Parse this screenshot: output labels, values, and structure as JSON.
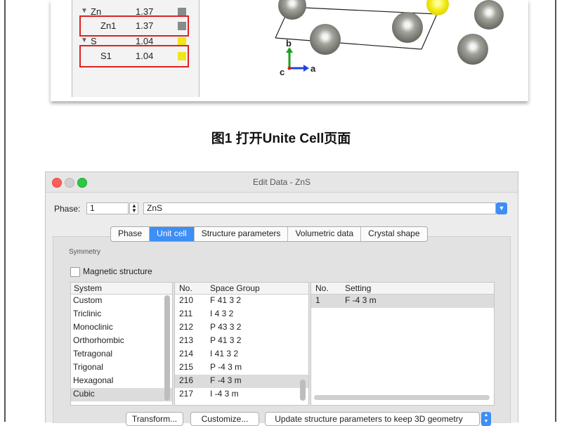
{
  "top_panel": {
    "tree": [
      {
        "name": "Zn",
        "value": "1.37",
        "color": "#8a8a8a",
        "expanded": true
      },
      {
        "name": "Zn1",
        "value": "1.37",
        "color": "#8a8a8a",
        "highlighted": true
      },
      {
        "name": "S",
        "value": "1.04",
        "color": "#f0e61a",
        "expanded": true
      },
      {
        "name": "S1",
        "value": "1.04",
        "color": "#f0e61a",
        "highlighted": true
      }
    ],
    "axes": {
      "b": "b",
      "c": "c",
      "a": "a"
    }
  },
  "caption": "图1 打开Unite Cell页面",
  "dialog": {
    "title": "Edit Data - ZnS",
    "phase_label": "Phase:",
    "phase_value": "1",
    "phase_name": "ZnS",
    "tabs": [
      "Phase",
      "Unit cell",
      "Structure parameters",
      "Volumetric data",
      "Crystal shape"
    ],
    "active_tab": "Unit cell",
    "symmetry_label": "Symmetry",
    "magnetic_label": "Magnetic structure",
    "system_header": "System",
    "systems": [
      "Custom",
      "Triclinic",
      "Monoclinic",
      "Orthorhombic",
      "Tetragonal",
      "Trigonal",
      "Hexagonal",
      "Cubic"
    ],
    "selected_system": "Cubic",
    "space_group_headers": {
      "no": "No.",
      "name": "Space Group"
    },
    "space_groups": [
      {
        "no": "210",
        "name": "F 41 3 2"
      },
      {
        "no": "211",
        "name": "I 4 3 2"
      },
      {
        "no": "212",
        "name": "P 43 3 2"
      },
      {
        "no": "213",
        "name": "P 41 3 2"
      },
      {
        "no": "214",
        "name": "I 41 3 2"
      },
      {
        "no": "215",
        "name": "P -4 3 m"
      },
      {
        "no": "216",
        "name": "F -4 3 m"
      },
      {
        "no": "217",
        "name": "I -4 3 m"
      }
    ],
    "selected_space_group": "216",
    "setting_headers": {
      "no": "No.",
      "name": "Setting"
    },
    "settings": [
      {
        "no": "1",
        "name": "F -4 3 m"
      }
    ],
    "buttons": {
      "transform": "Transform...",
      "customize": "Customize...",
      "update_select": "Update structure parameters to keep 3D geometry"
    }
  }
}
